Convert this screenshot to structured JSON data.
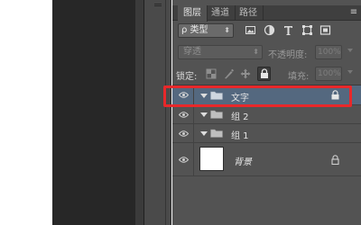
{
  "panel": {
    "tabs": [
      {
        "label": "图层",
        "active": true
      },
      {
        "label": "通道",
        "active": false
      },
      {
        "label": "路径",
        "active": false
      }
    ],
    "menu_glyph": "≡",
    "filter": {
      "type_label": "ρ 类型",
      "icons": [
        "image-filter-icon",
        "adjustment-filter-icon",
        "type-filter-icon",
        "shape-filter-icon",
        "smart-object-filter-icon"
      ]
    },
    "blend": {
      "mode": "穿透",
      "opacity_label": "不透明度:",
      "opacity_value": "100%"
    },
    "lock": {
      "label": "锁定:",
      "fill_label": "填充:",
      "fill_value": "100%"
    },
    "layers": [
      {
        "name": "文字",
        "type": "group",
        "selected": true,
        "locked": true,
        "visible": true
      },
      {
        "name": "组 2",
        "type": "group",
        "selected": false,
        "locked": false,
        "visible": true
      },
      {
        "name": "组 1",
        "type": "group",
        "selected": false,
        "locked": false,
        "visible": true
      },
      {
        "name": "背景",
        "type": "background",
        "selected": false,
        "locked": true,
        "visible": true
      }
    ]
  },
  "colors": {
    "panel_bg": "#535353",
    "selection": "#54687f",
    "highlight": "#e8282a"
  }
}
